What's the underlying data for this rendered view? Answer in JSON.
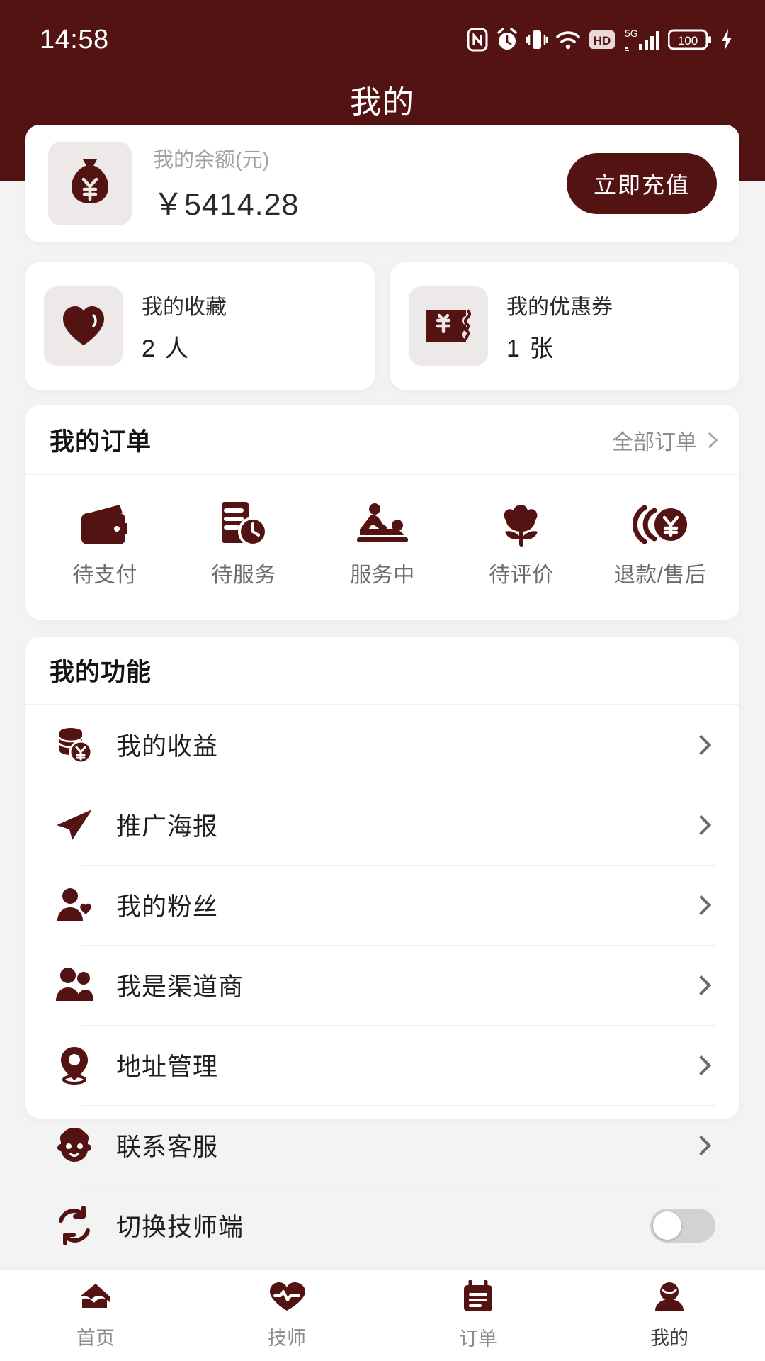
{
  "theme": {
    "brand": "#541313",
    "page_bg": "#f3f3f3",
    "card_bg": "#ffffff",
    "muted": "#8d8d8d"
  },
  "statusbar": {
    "time": "14:58",
    "icons": [
      "nfc-icon",
      "alarm-icon",
      "vibrate-icon",
      "wifi-icon",
      "hd-icon",
      "5g-signal-icon",
      "battery-icon",
      "charging-icon"
    ],
    "battery_level": "100"
  },
  "header": {
    "title": "我的"
  },
  "balance": {
    "icon": "money-bag-icon",
    "label": "我的余额(元)",
    "amount": "￥5414.28",
    "recharge_label": "立即充值"
  },
  "quick_cards": [
    {
      "icon": "heart-icon",
      "label": "我的收藏",
      "count": "2 人"
    },
    {
      "icon": "coupon-icon",
      "label": "我的优惠券",
      "count": "1 张"
    }
  ],
  "orders": {
    "title": "我的订单",
    "all_label": "全部订单",
    "tabs": [
      {
        "icon": "wallet-icon",
        "label": "待支付"
      },
      {
        "icon": "list-clock-icon",
        "label": "待服务"
      },
      {
        "icon": "massage-icon",
        "label": "服务中"
      },
      {
        "icon": "flower-icon",
        "label": "待评价"
      },
      {
        "icon": "refund-icon",
        "label": "退款/售后"
      }
    ]
  },
  "functions": {
    "title": "我的功能",
    "items": [
      {
        "icon": "coins-yuan-icon",
        "label": "我的收益",
        "control": "chevron"
      },
      {
        "icon": "paper-plane-icon",
        "label": "推广海报",
        "control": "chevron"
      },
      {
        "icon": "user-heart-icon",
        "label": "我的粉丝",
        "control": "chevron"
      },
      {
        "icon": "users-icon",
        "label": "我是渠道商",
        "control": "chevron"
      },
      {
        "icon": "location-pin-icon",
        "label": "地址管理",
        "control": "chevron"
      },
      {
        "icon": "customer-service-icon",
        "label": "联系客服",
        "control": "chevron"
      },
      {
        "icon": "switch-icon",
        "label": "切换技师端",
        "control": "toggle",
        "toggle_on": false
      }
    ]
  },
  "bottom_nav": {
    "active_index": 3,
    "items": [
      {
        "icon": "home-icon",
        "label": "首页"
      },
      {
        "icon": "technician-icon",
        "label": "技师"
      },
      {
        "icon": "order-icon",
        "label": "订单"
      },
      {
        "icon": "profile-icon",
        "label": "我的"
      }
    ]
  }
}
